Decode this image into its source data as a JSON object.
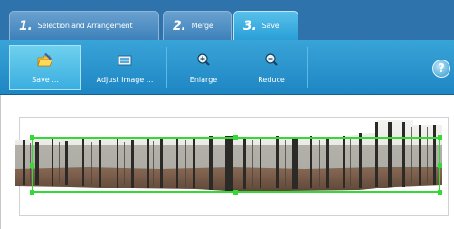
{
  "tabs": [
    {
      "num": "1.",
      "label": "Selection and Arrangement"
    },
    {
      "num": "2.",
      "label": "Merge"
    },
    {
      "num": "3.",
      "label": "Save"
    }
  ],
  "toolbar": {
    "save_label": "Save ...",
    "adjust_label": "Adjust Image ...",
    "enlarge_label": "Enlarge",
    "reduce_label": "Reduce",
    "help_label": "?"
  },
  "icons": {
    "save": "folder-pencil-icon",
    "adjust": "image-adjust-icon",
    "enlarge": "zoom-in-icon",
    "reduce": "zoom-out-icon",
    "help": "help-icon"
  },
  "colors": {
    "tab_active": "#2a9fd7",
    "toolbar": "#1e86c3",
    "crop_frame": "#35d935"
  }
}
